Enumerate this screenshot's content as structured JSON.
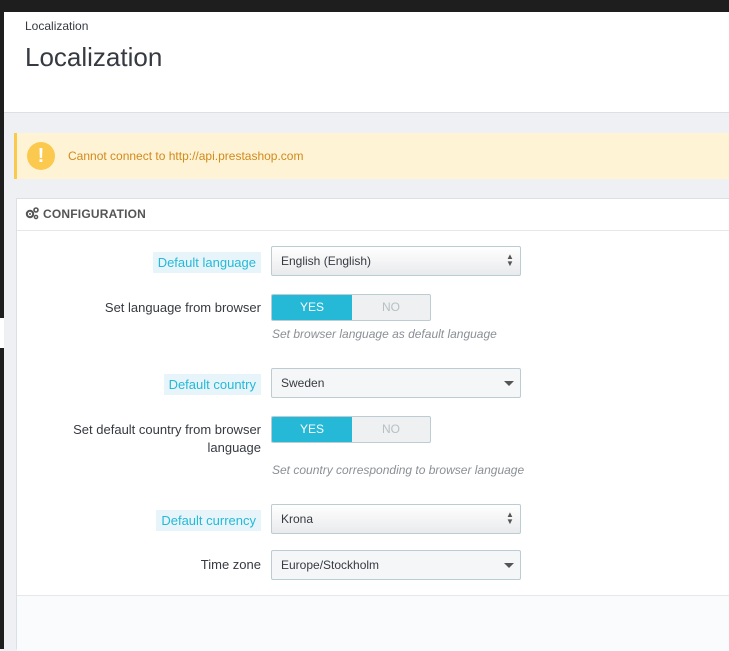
{
  "header": {
    "breadcrumb": "Localization",
    "title": "Localization"
  },
  "alert": {
    "icon": "warning-icon",
    "text": "Cannot connect to http://api.prestashop.com"
  },
  "panel": {
    "icon": "gears-icon",
    "title": "CONFIGURATION"
  },
  "fields": {
    "default_language": {
      "label": "Default language",
      "value": "English (English)"
    },
    "language_from_browser": {
      "label": "Set language from browser",
      "yes": "YES",
      "no": "NO",
      "selected": "YES",
      "help": "Set browser language as default language"
    },
    "default_country": {
      "label": "Default country",
      "value": "Sweden"
    },
    "country_from_browser": {
      "label_line1": "Set default country from browser",
      "label_line2": "language",
      "yes": "YES",
      "no": "NO",
      "selected": "YES",
      "help": "Set country corresponding to browser language"
    },
    "default_currency": {
      "label": "Default currency",
      "value": "Krona"
    },
    "time_zone": {
      "label": "Time zone",
      "value": "Europe/Stockholm"
    }
  },
  "colors": {
    "accent": "#25b9d7",
    "warning": "#fcc94f",
    "warning_text": "#d18a1b"
  }
}
